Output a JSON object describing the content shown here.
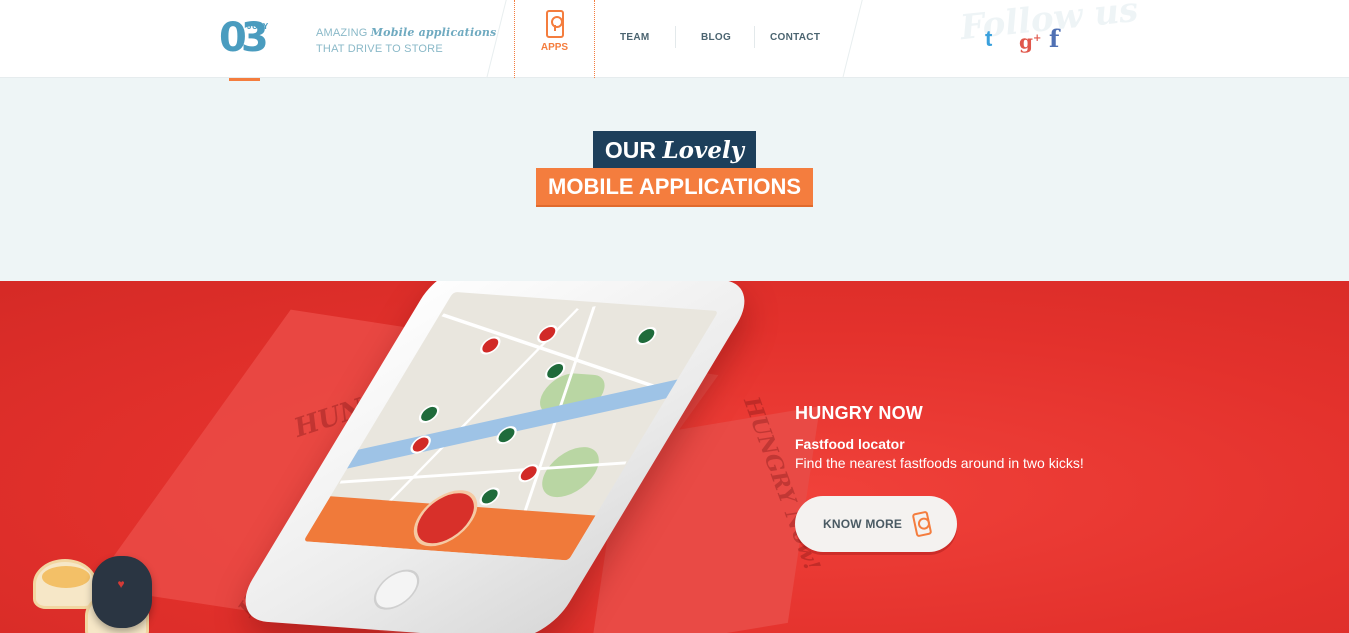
{
  "header": {
    "logo_number": "03",
    "logo_month": "JULY",
    "tagline_prefix": "AMAZING",
    "tagline_script": "Mobile applications",
    "tagline_line2": "THAT DRIVE TO STORE",
    "nav": {
      "apps": "APPS",
      "team": "TEAM",
      "blog": "BLOG",
      "contact": "CONTACT"
    },
    "follow_script": "Follow us",
    "social": {
      "twitter": "t",
      "gplus": "g",
      "gplus_sup": "+",
      "facebook": "f"
    }
  },
  "hero": {
    "title_prefix": "OUR",
    "title_script": "Lovely",
    "title_line2": "MOBILE APPLICATIONS"
  },
  "app": {
    "name": "HUNGRY NOW",
    "subtitle": "Fastfood locator",
    "description": "Find the nearest fastfoods around in two kicks!",
    "cta_label": "KNOW MORE",
    "box_print": "HUNGRY Now!"
  },
  "colors": {
    "accent": "#f47d3e",
    "navy": "#1d3f5b",
    "red": "#e3312c",
    "logo_blue": "#4a9cbf"
  },
  "icons": {
    "apps": "phone-pin-icon",
    "cta": "phone-pin-icon",
    "social": [
      "twitter-icon",
      "google-plus-icon",
      "facebook-icon"
    ]
  }
}
